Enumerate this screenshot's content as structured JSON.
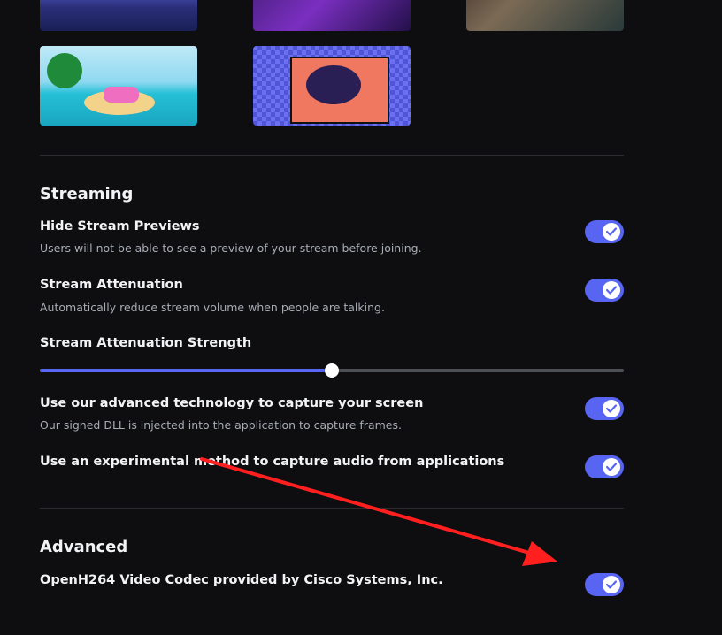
{
  "streaming": {
    "title": "Streaming",
    "hide_previews": {
      "label": "Hide Stream Previews",
      "description": "Users will not be able to see a preview of your stream before joining.",
      "enabled": true
    },
    "attenuation": {
      "label": "Stream Attenuation",
      "description": "Automatically reduce stream volume when people are talking.",
      "enabled": true
    },
    "attenuation_strength": {
      "label": "Stream Attenuation Strength",
      "value_fraction": 0.5
    },
    "advanced_capture": {
      "label": "Use our advanced technology to capture your screen",
      "description": "Our signed DLL is injected into the application to capture frames.",
      "enabled": true
    },
    "experimental_audio": {
      "label": "Use an experimental method to capture audio from applications",
      "enabled": true
    }
  },
  "advanced": {
    "title": "Advanced",
    "openh264": {
      "label": "OpenH264 Video Codec provided by Cisco Systems, Inc.",
      "enabled": true
    }
  },
  "colors": {
    "accent": "#5865f2",
    "background": "#0e0e11",
    "annotation_arrow": "#ff1f1f"
  },
  "icons": {
    "toggle_check": "checkmark-icon"
  }
}
